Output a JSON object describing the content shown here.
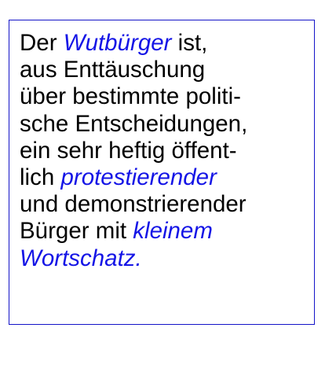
{
  "accent_color": "#1414e6",
  "border_color": "#1414c8",
  "lines": [
    {
      "pre": "Der ",
      "em": "Wutbürger",
      "post": " ist,"
    },
    {
      "pre": "aus Enttäuschung",
      "em": "",
      "post": ""
    },
    {
      "pre": "über bestimmte politi-",
      "em": "",
      "post": ""
    },
    {
      "pre": "sche Entscheidungen,",
      "em": "",
      "post": ""
    },
    {
      "pre": "ein sehr heftig öffent-",
      "em": "",
      "post": ""
    },
    {
      "pre": "lich ",
      "em": "protestierender",
      "post": ""
    },
    {
      "pre": "und demonstrierender",
      "em": "",
      "post": ""
    },
    {
      "pre": "Bürger mit ",
      "em": "kleinem",
      "post": ""
    },
    {
      "pre": "",
      "em": "Wortschatz.",
      "post": ""
    }
  ]
}
